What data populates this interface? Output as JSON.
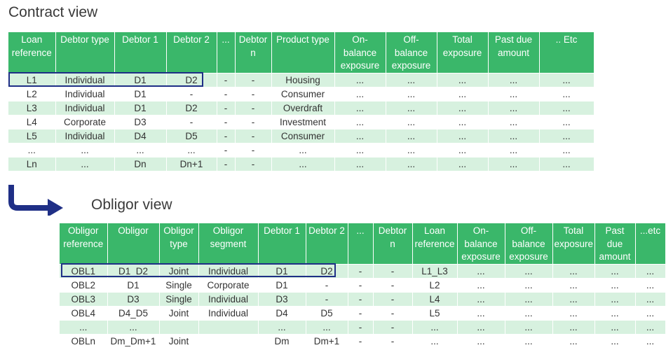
{
  "contract": {
    "title": "Contract view",
    "headers": [
      "Loan reference",
      "Debtor type",
      "Debtor 1",
      "Debtor 2",
      "...",
      "Debtor n",
      "Product type",
      "On-balance exposure",
      "Off-balance exposure",
      "Total exposure",
      "Past due amount",
      ".. Etc"
    ],
    "rows": [
      [
        "L1",
        "Individual",
        "D1",
        "D2",
        "-",
        "-",
        "Housing",
        "...",
        "...",
        "...",
        "...",
        "..."
      ],
      [
        "L2",
        "Individual",
        "D1",
        "-",
        "-",
        "-",
        "Consumer",
        "...",
        "...",
        "...",
        "...",
        "..."
      ],
      [
        "L3",
        "Individual",
        "D1",
        "D2",
        "-",
        "-",
        "Overdraft",
        "...",
        "...",
        "...",
        "...",
        "..."
      ],
      [
        "L4",
        "Corporate",
        "D3",
        "-",
        "-",
        "-",
        "Investment",
        "...",
        "...",
        "...",
        "...",
        "..."
      ],
      [
        "L5",
        "Individual",
        "D4",
        "D5",
        "-",
        "-",
        "Consumer",
        "...",
        "...",
        "...",
        "...",
        "..."
      ],
      [
        "...",
        "...",
        "...",
        "...",
        "-",
        "-",
        "...",
        "...",
        "...",
        "...",
        "...",
        "..."
      ],
      [
        "Ln",
        "...",
        "Dn",
        "Dn+1",
        "-",
        "-",
        "...",
        "...",
        "...",
        "...",
        "...",
        "..."
      ]
    ]
  },
  "obligor": {
    "title": "Obligor view",
    "headers": [
      "Obligor reference",
      "Obligor",
      "Obligor type",
      "Obligor segment",
      "Debtor 1",
      "Debtor 2",
      "...",
      "Debtor n",
      "Loan reference",
      "On-balance exposure",
      "Off-balance exposure",
      "Total exposure",
      "Past due amount",
      "...etc"
    ],
    "rows": [
      [
        "OBL1",
        "D1_D2",
        "Joint",
        "Individual",
        "D1",
        "D2",
        "-",
        "-",
        "L1_L3",
        "...",
        "...",
        "...",
        "...",
        "..."
      ],
      [
        "OBL2",
        "D1",
        "Single",
        "Corporate",
        "D1",
        "-",
        "-",
        "-",
        "L2",
        "...",
        "...",
        "...",
        "...",
        "..."
      ],
      [
        "OBL3",
        "D3",
        "Single",
        "Individual",
        "D3",
        "-",
        "-",
        "-",
        "L4",
        "...",
        "...",
        "...",
        "...",
        "..."
      ],
      [
        "OBL4",
        "D4_D5",
        "Joint",
        "Individual",
        "D4",
        "D5",
        "-",
        "-",
        "L5",
        "...",
        "...",
        "...",
        "...",
        "..."
      ],
      [
        "...",
        "...",
        "",
        "",
        "...",
        "...",
        "-",
        "-",
        "...",
        "...",
        "...",
        "...",
        "...",
        "..."
      ],
      [
        "OBLn",
        "Dm_Dm+1",
        "Joint",
        "",
        "Dm",
        "Dm+1",
        "-",
        "-",
        "...",
        "...",
        "...",
        "...",
        "...",
        "..."
      ]
    ]
  },
  "colors": {
    "header_green": "#3ab76a",
    "row_light_green": "#d7f1df",
    "highlight_navy": "#1f2f86",
    "arrow_navy": "#1f2f86"
  },
  "icons": {
    "transition": "bent-arrow-icon"
  }
}
